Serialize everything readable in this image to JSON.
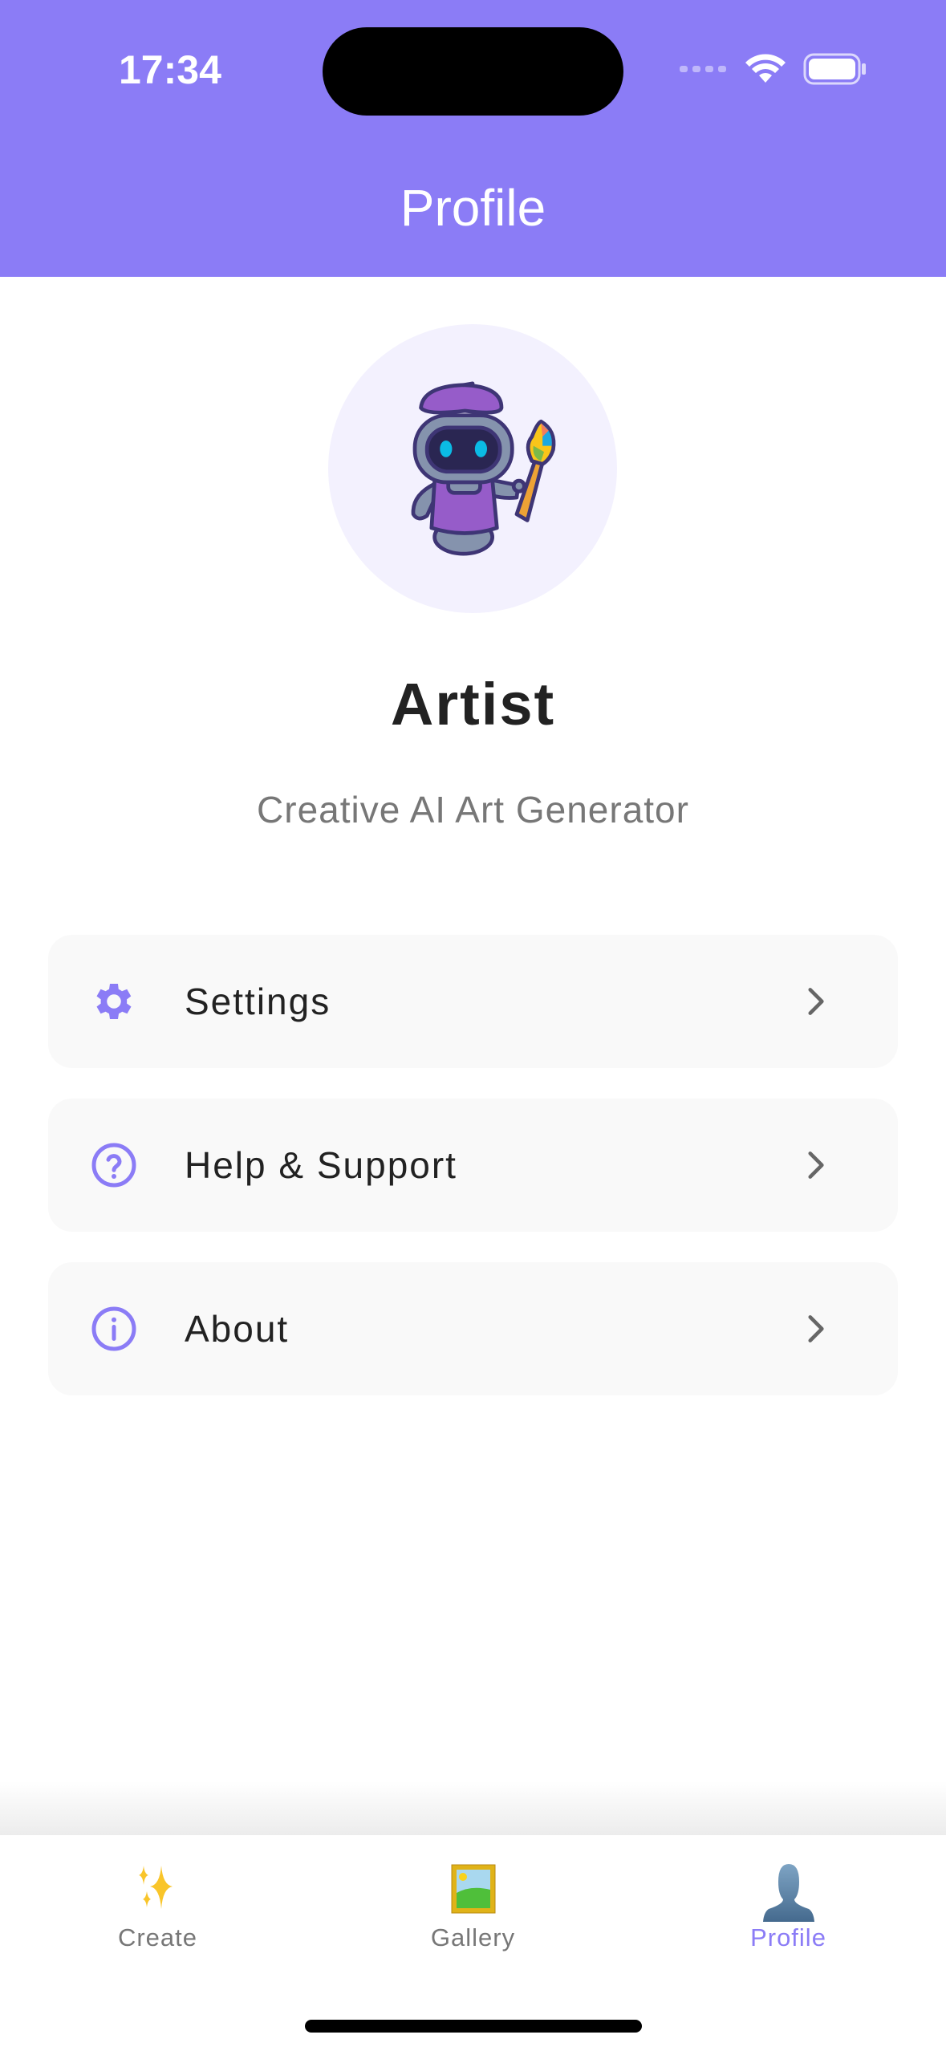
{
  "status_bar": {
    "time": "17:34"
  },
  "header": {
    "title": "Profile"
  },
  "profile": {
    "name": "Artist",
    "subtitle": "Creative AI Art Generator"
  },
  "menu": [
    {
      "label": "Settings",
      "icon": "gear-icon"
    },
    {
      "label": "Help & Support",
      "icon": "question-circle-icon"
    },
    {
      "label": "About",
      "icon": "info-circle-icon"
    }
  ],
  "tabs": [
    {
      "label": "Create",
      "icon": "sparkles-icon",
      "active": false
    },
    {
      "label": "Gallery",
      "icon": "framed-picture-icon",
      "active": false
    },
    {
      "label": "Profile",
      "icon": "person-silhouette-icon",
      "active": true
    }
  ],
  "colors": {
    "accent": "#8b7cf6",
    "card": "#f9f9f9",
    "avatar_bg": "#f3f1fe"
  }
}
